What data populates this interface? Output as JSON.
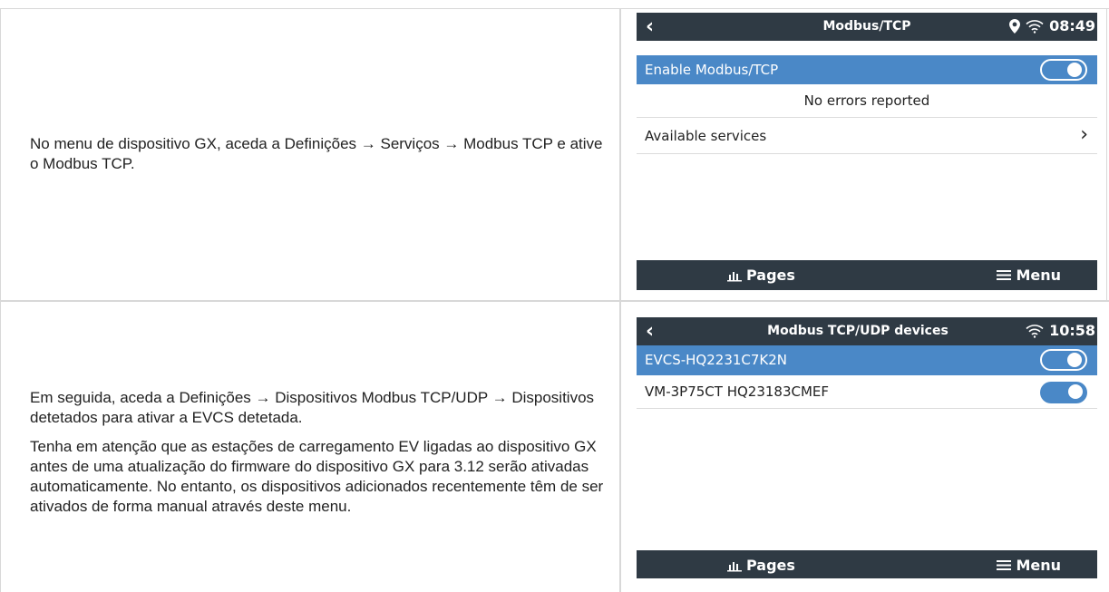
{
  "row1": {
    "description": "No menu de dispositivo GX, aceda a Definições → Serviços → Modbus TCP e ative o Modbus TCP.",
    "screen": {
      "title": "Modbus/TCP",
      "time": "08:49",
      "enable_label": "Enable Modbus/TCP",
      "status_text": "No errors reported",
      "services_label": "Available services",
      "pages_label": "Pages",
      "menu_label": "Menu"
    }
  },
  "row2": {
    "description_1": "Em seguida, aceda a Definições → Dispositivos Modbus TCP/UDP → Dispositivos detetados para ativar a EVCS detetada.",
    "description_2": "Tenha em atenção que as estações de carregamento EV ligadas ao dispositivo GX antes de uma atualização do firmware do dispositivo GX para 3.12 serão ativadas automaticamente. No entanto, os dispositivos adicionados recentemente têm de ser ativados de forma manual através deste menu.",
    "screen": {
      "title": "Modbus TCP/UDP devices",
      "time": "10:58",
      "devices": [
        {
          "label": "EVCS-HQ2231C7K2N",
          "enabled": true
        },
        {
          "label": "VM-3P75CT HQ23183CMEF",
          "enabled": true
        }
      ],
      "pages_label": "Pages",
      "menu_label": "Menu"
    }
  },
  "colors": {
    "topbar": "#2f3a44",
    "selected": "#4a88c7",
    "grid": "#d8d8d8"
  },
  "icons": [
    "back-chevron-icon",
    "location-pin-icon",
    "wifi-icon",
    "chevron-right-icon",
    "pages-icon",
    "menu-icon"
  ]
}
